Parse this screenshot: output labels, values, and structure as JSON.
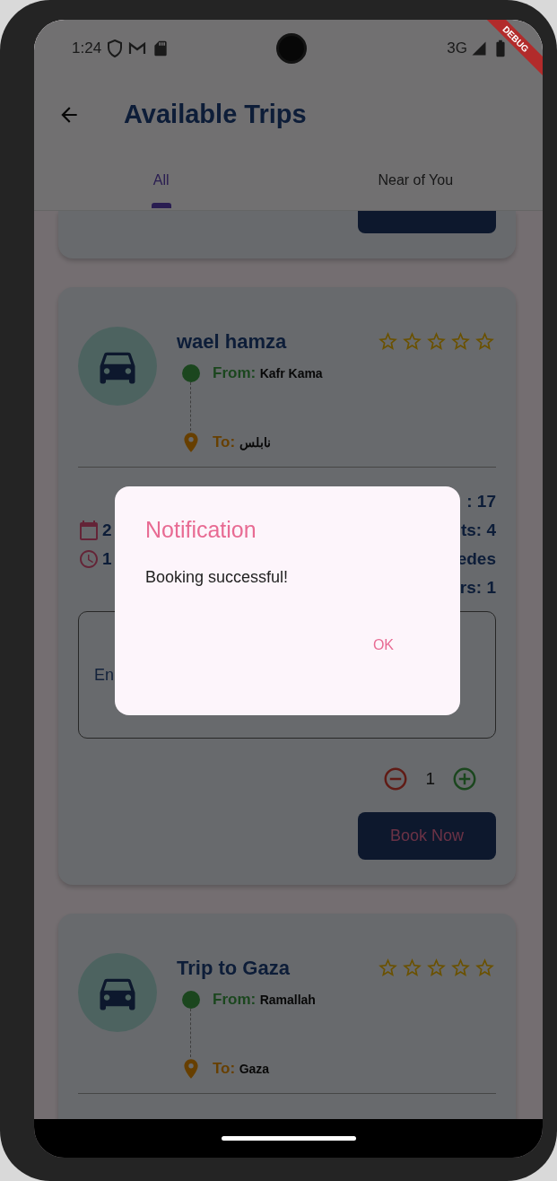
{
  "status_bar": {
    "time": "1:24",
    "network": "3G"
  },
  "debug_banner": "DEBUG",
  "app_bar": {
    "title": "Available Trips"
  },
  "tabs": [
    {
      "label": "All",
      "selected": true
    },
    {
      "label": "Near of You",
      "selected": false
    }
  ],
  "trips": [
    {
      "kind": "stub"
    },
    {
      "kind": "full",
      "title": "wael hamza",
      "stars": 0,
      "from_label": "From:",
      "from": "Kafr Kama",
      "to_label": "To:",
      "to": "نابلس",
      "date": "2",
      "time": "1",
      "details": [
        ": 17",
        "ts: 4",
        "edes",
        "rs: 1"
      ],
      "note": {
        "placeholder": "En"
      },
      "seats": "1",
      "button": "Book Now"
    },
    {
      "kind": "partial",
      "title": "Trip to Gaza",
      "stars": 0,
      "from_label": "From:",
      "from": "Ramallah",
      "to_label": "To:",
      "to": "Gaza"
    }
  ],
  "dialog": {
    "title": "Notification",
    "message": "Booking successful!",
    "button": "OK"
  }
}
